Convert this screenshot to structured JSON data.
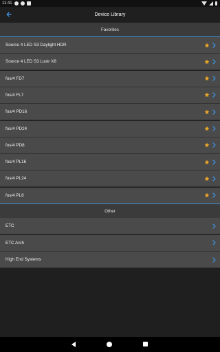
{
  "status_bar": {
    "time": "11:41"
  },
  "app_bar": {
    "title": "Device Library"
  },
  "sections": {
    "favorites": {
      "header": "Favorites",
      "items": [
        {
          "label": "Source 4 LED S3 Daylight HDR",
          "favorite": true
        },
        {
          "label": "Source 4 LED S3 Lustr X8",
          "favorite": true
        },
        {
          "label": "fos/4 FD7",
          "favorite": true
        },
        {
          "label": "fos/4 FL7",
          "favorite": true
        },
        {
          "label": "fos/4 PD16",
          "favorite": true
        },
        {
          "label": "fos/4 PD24",
          "favorite": true
        },
        {
          "label": "fos/4 PD8",
          "favorite": true
        },
        {
          "label": "fos/4 PL16",
          "favorite": true
        },
        {
          "label": "fos/4 PL24",
          "favorite": true
        },
        {
          "label": "fos/4 PL8",
          "favorite": true
        }
      ]
    },
    "other": {
      "header": "Other",
      "items": [
        {
          "label": "ETC"
        },
        {
          "label": "ETC Arch"
        },
        {
          "label": "High End Systems"
        }
      ]
    }
  },
  "colors": {
    "accent": "#3f8fd6",
    "star": "#e8a52a",
    "row_bg": "#4a4a4a",
    "header_bg": "#3b3b3b",
    "page_bg": "#1f1f1f"
  },
  "icons": {
    "back": "arrow-back-icon",
    "favorite": "star-icon",
    "disclosure": "chevron-right-icon"
  }
}
